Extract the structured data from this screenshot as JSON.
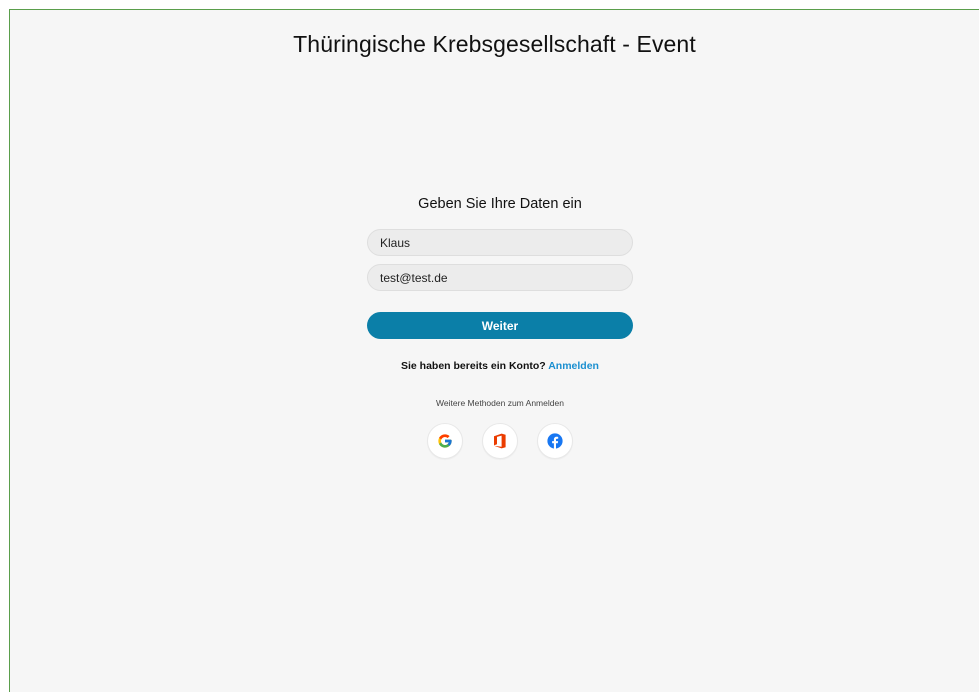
{
  "page": {
    "title": "Thüringische Krebsgesellschaft - Event"
  },
  "form": {
    "heading": "Geben Sie Ihre Daten ein",
    "name_value": "Klaus",
    "email_value": "test@test.de",
    "submit_label": "Weiter"
  },
  "account": {
    "question": "Sie haben bereits ein Konto? ",
    "login_link": "Anmelden"
  },
  "social": {
    "caption": "Weitere Methoden zum Anmelden",
    "providers": [
      {
        "name": "Google",
        "icon": "google-icon"
      },
      {
        "name": "Office",
        "icon": "office-icon"
      },
      {
        "name": "Facebook",
        "icon": "facebook-icon"
      }
    ]
  },
  "colors": {
    "primary_button": "#0b7fa8",
    "link": "#1a8fd0",
    "background": "#f6f6f6",
    "frame_border": "#5a9e4b"
  }
}
